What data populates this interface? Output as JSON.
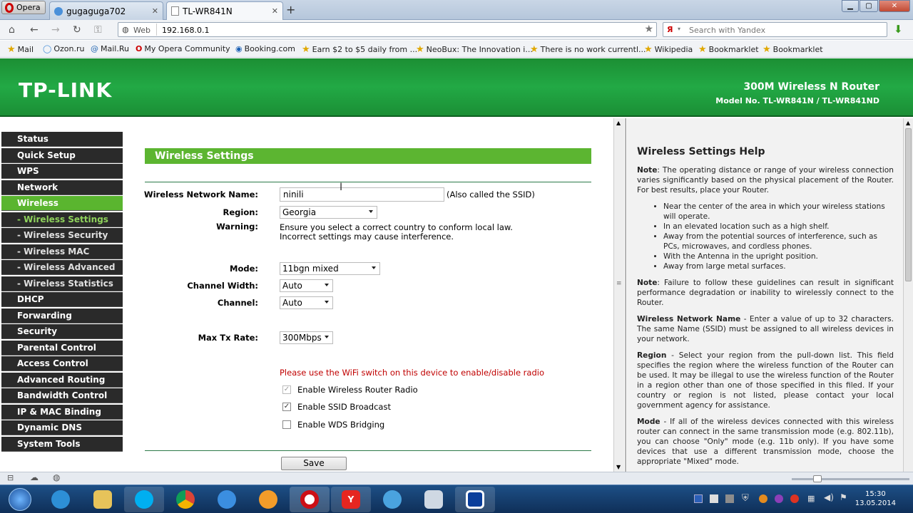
{
  "browser": {
    "opera_label": "Opera",
    "tabs": [
      {
        "title": "gugaguga702"
      },
      {
        "title": "TL-WR841N"
      }
    ],
    "web_label": "Web",
    "address": "192.168.0.1",
    "search_placeholder": "Search with Yandex",
    "bookmarks": [
      "Mail",
      "Ozon.ru",
      "Mail.Ru",
      "My Opera Community",
      "Booking.com",
      "Earn $2 to $5 daily from ...",
      "NeoBux: The Innovation i...",
      "There is no work currentl...",
      "Wikipedia",
      "Bookmarklet",
      "Bookmarklet"
    ]
  },
  "router": {
    "logo": "TP-LINK",
    "product": "300M Wireless N Router",
    "model": "Model No. TL-WR841N / TL-WR841ND",
    "menu": [
      {
        "label": "Status",
        "type": "main"
      },
      {
        "label": "Quick Setup",
        "type": "main"
      },
      {
        "label": "WPS",
        "type": "main"
      },
      {
        "label": "Network",
        "type": "main"
      },
      {
        "label": "Wireless",
        "type": "active"
      },
      {
        "label": "- Wireless Settings",
        "type": "subactive"
      },
      {
        "label": "- Wireless Security",
        "type": "sub"
      },
      {
        "label": "- Wireless MAC Filtering",
        "type": "sub"
      },
      {
        "label": "- Wireless Advanced",
        "type": "sub"
      },
      {
        "label": "- Wireless Statistics",
        "type": "sub"
      },
      {
        "label": "DHCP",
        "type": "main"
      },
      {
        "label": "Forwarding",
        "type": "main"
      },
      {
        "label": "Security",
        "type": "main"
      },
      {
        "label": "Parental Control",
        "type": "main"
      },
      {
        "label": "Access Control",
        "type": "main"
      },
      {
        "label": "Advanced Routing",
        "type": "main"
      },
      {
        "label": "Bandwidth Control",
        "type": "main"
      },
      {
        "label": "IP & MAC Binding",
        "type": "main"
      },
      {
        "label": "Dynamic DNS",
        "type": "main"
      },
      {
        "label": "System Tools",
        "type": "main"
      }
    ]
  },
  "form": {
    "title": "Wireless Settings",
    "ssid_label": "Wireless Network Name:",
    "ssid_value": "ninili",
    "ssid_note": "(Also called the SSID)",
    "region_label": "Region:",
    "region_value": "Georgia",
    "warning_label": "Warning:",
    "warning_line1": "Ensure you select a correct country to conform local law.",
    "warning_line2": "Incorrect settings may cause interference.",
    "mode_label": "Mode:",
    "mode_value": "11bgn mixed",
    "width_label": "Channel Width:",
    "width_value": "Auto",
    "channel_label": "Channel:",
    "channel_value": "Auto",
    "rate_label": "Max Tx Rate:",
    "rate_value": "300Mbps",
    "radio_note": "Please use the WiFi switch on this device to enable/disable radio",
    "cb_radio": "Enable Wireless Router Radio",
    "cb_ssid": "Enable SSID Broadcast",
    "cb_wds": "Enable WDS Bridging",
    "save": "Save"
  },
  "help": {
    "title": "Wireless Settings Help",
    "note1_bold": "Note",
    "note1": ": The operating distance or range of your wireless connection varies significantly based on the physical placement of the Router. For best results, place your Router.",
    "bullets": [
      "Near the center of the area in which your wireless stations will operate.",
      "In an elevated location such as a high shelf.",
      "Away from the potential sources of interference, such as PCs, microwaves, and cordless phones.",
      "With the Antenna in the upright position.",
      "Away from large metal surfaces."
    ],
    "note2_bold": "Note",
    "note2": ": Failure to follow these guidelines can result in significant performance degradation or inability to wirelessly connect to the Router.",
    "wnn_bold": "Wireless Network Name",
    "wnn": " - Enter a value of up to 32 characters. The same Name (SSID) must be assigned to all wireless devices in your network.",
    "region_bold": "Region",
    "region": " - Select your region from the pull-down list. This field specifies the region where the wireless function of the Router can be used. It may be illegal to use the wireless function of the Router in a region other than one of those specified in this filed. If your country or region is not listed, please contact your local government agency for assistance.",
    "mode_bold": "Mode",
    "mode": " - If all of the wireless devices connected with this wireless router can connect in the same transmission mode (e.g. 802.11b), you can choose \"Only\" mode (e.g. 11b only). If you have some devices that use a different transmission mode, choose the appropriate \"Mixed\" mode."
  },
  "taskbar": {
    "time": "15:30",
    "date": "13.05.2014"
  },
  "colors": {
    "green": "#5cb531",
    "header": "#22a945",
    "menu_bg": "#2a2a2a",
    "warning_red": "#c00000"
  }
}
